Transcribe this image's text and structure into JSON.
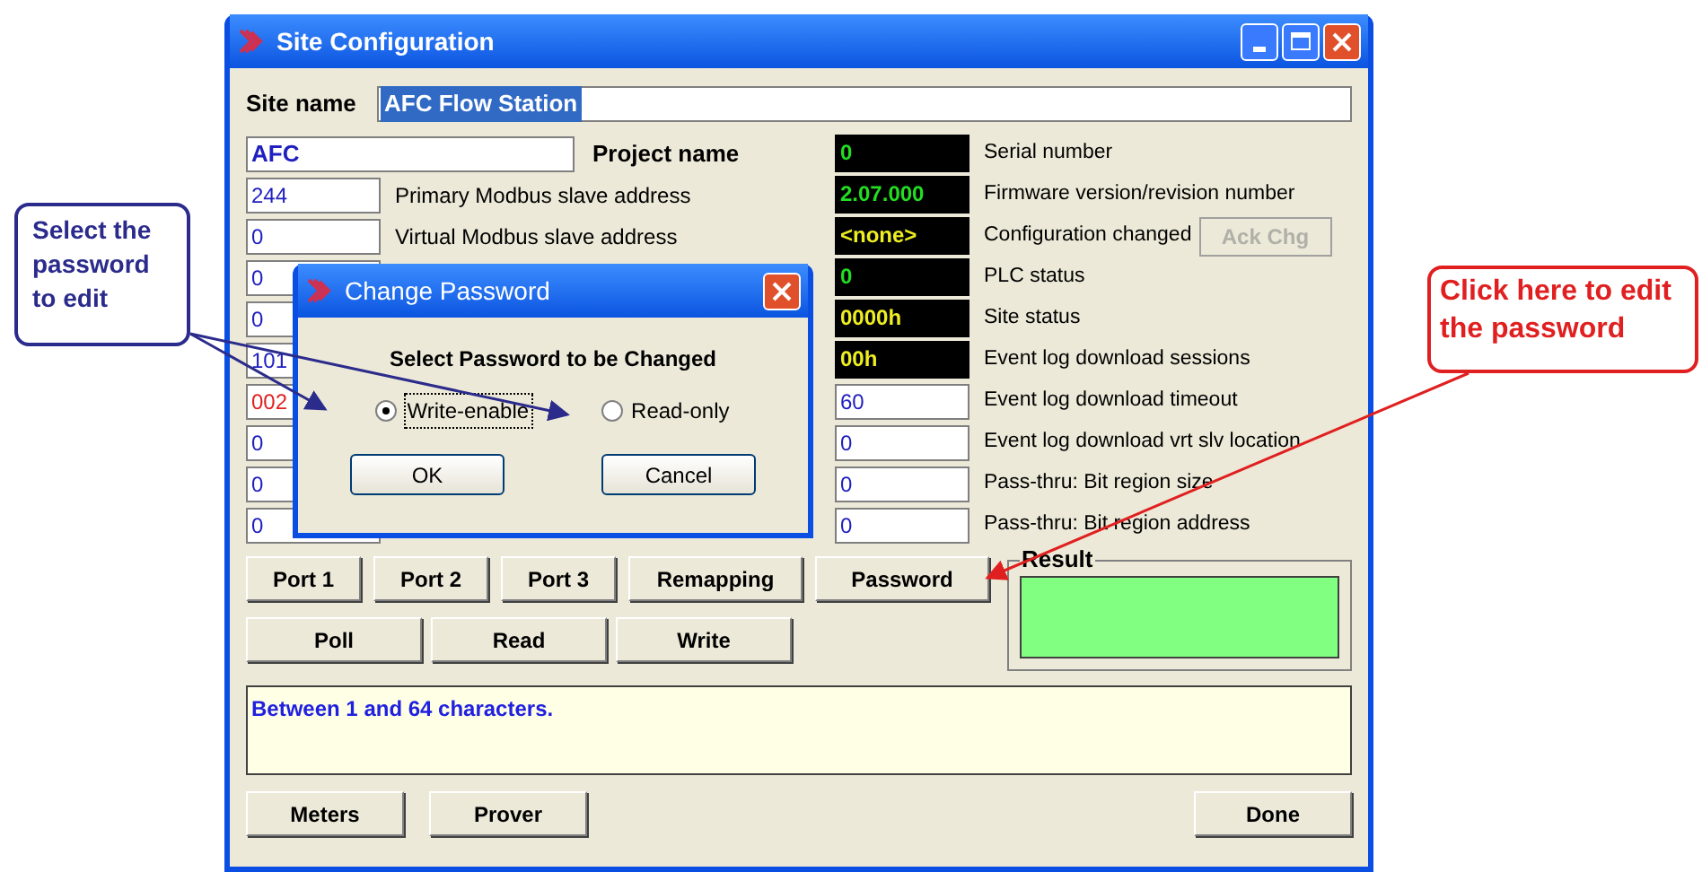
{
  "window": {
    "title": "Site Configuration"
  },
  "site_name": {
    "label": "Site name",
    "value": "AFC Flow Station",
    "selected": true
  },
  "project": {
    "value": "AFC",
    "label": "Project name"
  },
  "left_fields": [
    {
      "value": "244",
      "label": "Primary Modbus slave address",
      "invalid": false
    },
    {
      "value": "0",
      "label": "Virtual Modbus slave address",
      "invalid": false
    },
    {
      "value": "0",
      "invalid": false
    },
    {
      "value": "0",
      "invalid": false
    },
    {
      "value": "101",
      "invalid": false
    },
    {
      "value": "002",
      "invalid": true
    },
    {
      "value": "0",
      "invalid": false
    },
    {
      "value": "0",
      "invalid": false
    },
    {
      "value": "0",
      "invalid": false
    }
  ],
  "right_fields": [
    {
      "kind": "readout",
      "value": "0",
      "warning": false,
      "label": "Serial number"
    },
    {
      "kind": "readout",
      "value": "2.07.000",
      "warning": false,
      "label": "Firmware version/revision number"
    },
    {
      "kind": "readout",
      "value": "<none>",
      "warning": true,
      "label": "Configuration changed",
      "button": {
        "label": "Ack Chg",
        "disabled": true
      }
    },
    {
      "kind": "readout",
      "value": "0",
      "warning": false,
      "label": "PLC status"
    },
    {
      "kind": "readout",
      "value": "0000h",
      "warning": true,
      "label": "Site status"
    },
    {
      "kind": "readout",
      "value": "00h",
      "warning": true,
      "label": "Event log download sessions"
    },
    {
      "kind": "input",
      "value": "60",
      "label": "Event log download timeout"
    },
    {
      "kind": "input",
      "value": "0",
      "label": "Event log download vrt slv location"
    },
    {
      "kind": "input",
      "value": "0",
      "label": "Pass-thru: Bit region size"
    },
    {
      "kind": "input",
      "value": "0",
      "label": "Pass-thru: Bit region address"
    }
  ],
  "buttons_row_1": [
    "Port 1",
    "Port 2",
    "Port 3",
    "Remapping",
    "Password"
  ],
  "buttons_row_2": [
    "Poll",
    "Read",
    "Write"
  ],
  "result": {
    "label": "Result",
    "color": "#80ff80"
  },
  "message": "Between 1 and 64 characters.",
  "bottom_buttons": [
    "Meters",
    "Prover",
    "Done"
  ],
  "dialog": {
    "title": "Change Password",
    "heading": "Select Password to be Changed",
    "options": [
      {
        "label": "Write-enable",
        "selected": true
      },
      {
        "label": "Read-only",
        "selected": false
      }
    ],
    "buttons": [
      "OK",
      "Cancel"
    ]
  },
  "callouts": [
    {
      "text": "Select the password to edit",
      "color": "#2b2b8c"
    },
    {
      "text": "Click here to edit the password",
      "color": "#e02020"
    }
  ]
}
